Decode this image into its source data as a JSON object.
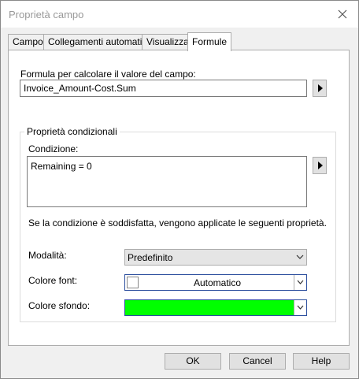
{
  "window": {
    "title": "Proprietà campo"
  },
  "tabs": [
    {
      "label": "Campo"
    },
    {
      "label": "Collegamenti automatici"
    },
    {
      "label": "Visualizza"
    },
    {
      "label": "Formule"
    }
  ],
  "formula": {
    "label": "Formula per calcolare il valore del campo:",
    "value": "Invoice_Amount-Cost.Sum"
  },
  "conditional": {
    "group_title": "Proprietà condizionali",
    "condition_label": "Condizione:",
    "condition_value": "Remaining = 0",
    "info_text": "Se la condizione è soddisfatta, vengono applicate le seguenti proprietà.",
    "mode_label": "Modalità:",
    "mode_value": "Predefinito",
    "font_color_label": "Colore font:",
    "font_color_value": "Automatico",
    "font_color_swatch": "#ffffff",
    "bg_color_label": "Colore sfondo:",
    "bg_color_swatch": "#00ff00"
  },
  "buttons": {
    "ok": "OK",
    "cancel": "Cancel",
    "help": "Help"
  }
}
